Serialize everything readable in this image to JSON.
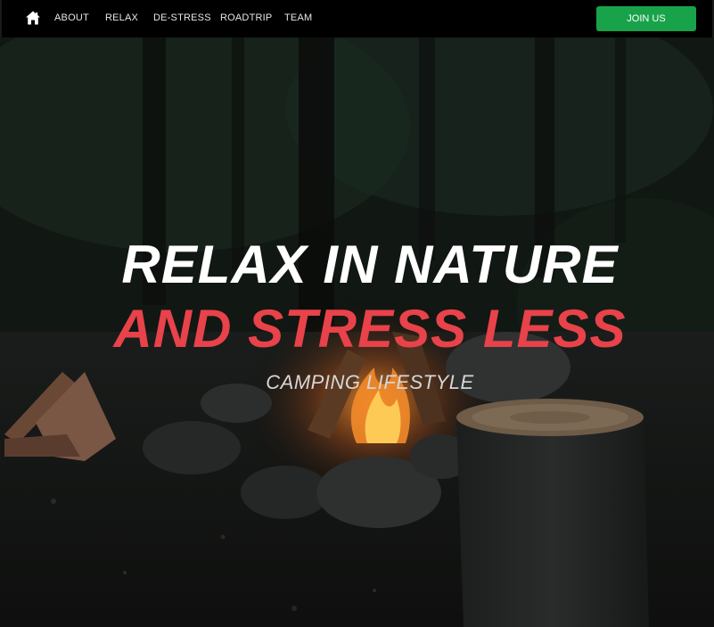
{
  "nav": {
    "home_icon": "home-icon",
    "links": [
      {
        "label": "ABOUT"
      },
      {
        "label": "RELAX"
      },
      {
        "label": "DE-STRESS"
      },
      {
        "label": "ROADTRIP"
      },
      {
        "label": "TEAM"
      }
    ],
    "join_label": "JOIN US",
    "join_color": "#18a34a"
  },
  "hero": {
    "title_line1": "RELAX IN NATURE",
    "title_line2": "AND STRESS LESS",
    "subtitle": "CAMPING LIFESTYLE",
    "accent_color": "#e8424a"
  }
}
